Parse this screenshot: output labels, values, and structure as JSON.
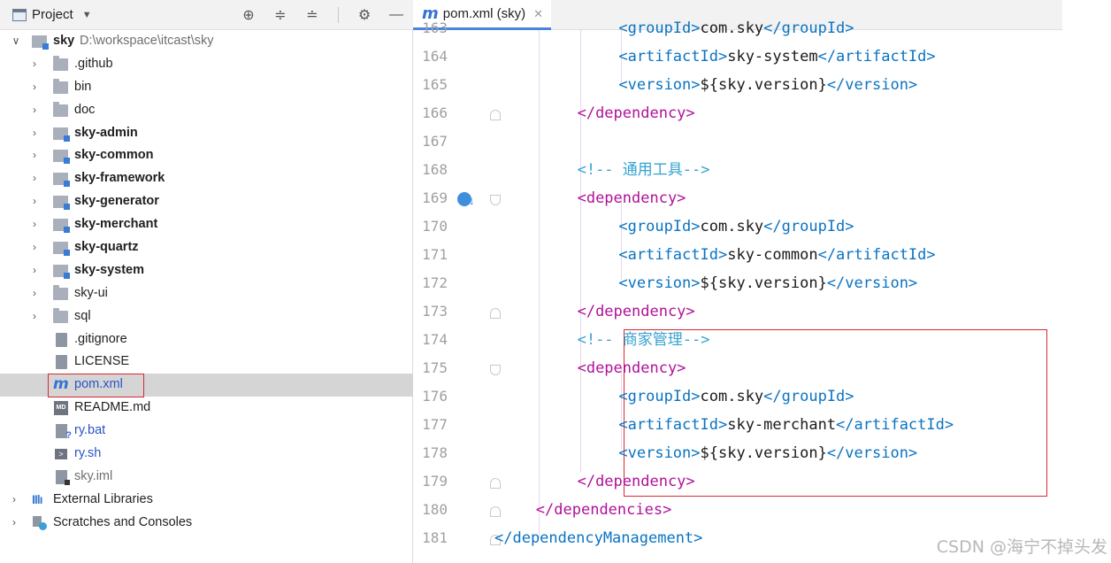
{
  "panel": {
    "title": "Project",
    "header_icons": [
      "locate-icon",
      "expand-all-icon",
      "collapse-all-icon",
      "gear-icon",
      "hide-icon"
    ]
  },
  "tree": {
    "root_name": "sky",
    "root_path": "D:\\workspace\\itcast\\sky",
    "items": [
      {
        "label": "sky",
        "path": "D:\\workspace\\itcast\\sky",
        "icon": "project-root-icon"
      },
      {
        "label": ".github",
        "icon": "folder-icon"
      },
      {
        "label": "bin",
        "icon": "folder-icon"
      },
      {
        "label": "doc",
        "icon": "folder-icon"
      },
      {
        "label": "sky-admin",
        "icon": "module-folder-icon"
      },
      {
        "label": "sky-common",
        "icon": "module-folder-icon"
      },
      {
        "label": "sky-framework",
        "icon": "module-folder-icon"
      },
      {
        "label": "sky-generator",
        "icon": "module-folder-icon"
      },
      {
        "label": "sky-merchant",
        "icon": "module-folder-icon"
      },
      {
        "label": "sky-quartz",
        "icon": "module-folder-icon"
      },
      {
        "label": "sky-system",
        "icon": "module-folder-icon"
      },
      {
        "label": "sky-ui",
        "icon": "folder-icon"
      },
      {
        "label": "sql",
        "icon": "folder-icon"
      },
      {
        "label": ".gitignore",
        "icon": "gitignore-file-icon"
      },
      {
        "label": "LICENSE",
        "icon": "text-file-icon"
      },
      {
        "label": "pom.xml",
        "icon": "maven-file-icon"
      },
      {
        "label": "README.md",
        "icon": "markdown-file-icon"
      },
      {
        "label": "ry.bat",
        "icon": "batch-file-icon"
      },
      {
        "label": "ry.sh",
        "icon": "shell-file-icon"
      },
      {
        "label": "sky.iml",
        "icon": "iml-file-icon"
      },
      {
        "label": "External Libraries",
        "icon": "libraries-icon"
      },
      {
        "label": "Scratches and Consoles",
        "icon": "scratches-icon"
      }
    ]
  },
  "editor": {
    "tab_label": "pom.xml (sky)",
    "tab_icon": "maven-file-icon",
    "lines": [
      {
        "num": "163",
        "parts": [
          {
            "c": "tag-blue",
            "t": "<groupId>"
          },
          {
            "c": "txt",
            "t": "com.sky"
          },
          {
            "c": "tag-blue",
            "t": "</groupId>"
          }
        ]
      },
      {
        "num": "164",
        "parts": [
          {
            "c": "tag-blue",
            "t": "<artifactId>"
          },
          {
            "c": "txt",
            "t": "sky-system"
          },
          {
            "c": "tag-blue",
            "t": "</artifactId>"
          }
        ]
      },
      {
        "num": "165",
        "parts": [
          {
            "c": "tag-blue",
            "t": "<version>"
          },
          {
            "c": "txt",
            "t": "${sky.version}"
          },
          {
            "c": "tag-blue",
            "t": "</version>"
          }
        ]
      },
      {
        "num": "166",
        "parts": [
          {
            "c": "tag",
            "t": "</dependency>"
          }
        ]
      },
      {
        "num": "167",
        "parts": []
      },
      {
        "num": "168",
        "parts": [
          {
            "c": "cmt",
            "t": "<!-- 通用工具-->"
          }
        ]
      },
      {
        "num": "169",
        "parts": [
          {
            "c": "tag",
            "t": "<dependency>"
          }
        ]
      },
      {
        "num": "170",
        "parts": [
          {
            "c": "tag-blue",
            "t": "<groupId>"
          },
          {
            "c": "txt",
            "t": "com.sky"
          },
          {
            "c": "tag-blue",
            "t": "</groupId>"
          }
        ]
      },
      {
        "num": "171",
        "parts": [
          {
            "c": "tag-blue",
            "t": "<artifactId>"
          },
          {
            "c": "txt",
            "t": "sky-common"
          },
          {
            "c": "tag-blue",
            "t": "</artifactId>"
          }
        ]
      },
      {
        "num": "172",
        "parts": [
          {
            "c": "tag-blue",
            "t": "<version>"
          },
          {
            "c": "txt",
            "t": "${sky.version}"
          },
          {
            "c": "tag-blue",
            "t": "</version>"
          }
        ]
      },
      {
        "num": "173",
        "parts": [
          {
            "c": "tag",
            "t": "</dependency>"
          }
        ]
      },
      {
        "num": "174",
        "parts": [
          {
            "c": "cmt",
            "t": "<!-- 商家管理-->"
          }
        ]
      },
      {
        "num": "175",
        "parts": [
          {
            "c": "tag",
            "t": "<dependency>"
          }
        ]
      },
      {
        "num": "176",
        "parts": [
          {
            "c": "tag-blue",
            "t": "<groupId>"
          },
          {
            "c": "txt",
            "t": "com.sky"
          },
          {
            "c": "tag-blue",
            "t": "</groupId>"
          }
        ]
      },
      {
        "num": "177",
        "parts": [
          {
            "c": "tag-blue",
            "t": "<artifactId>"
          },
          {
            "c": "txt",
            "t": "sky-merchant"
          },
          {
            "c": "tag-blue",
            "t": "</artifactId>"
          }
        ]
      },
      {
        "num": "178",
        "parts": [
          {
            "c": "tag-blue",
            "t": "<version>"
          },
          {
            "c": "txt",
            "t": "${sky.version}"
          },
          {
            "c": "tag-blue",
            "t": "</version>"
          }
        ]
      },
      {
        "num": "179",
        "parts": [
          {
            "c": "tag",
            "t": "</dependency>"
          }
        ]
      },
      {
        "num": "180",
        "parts": [
          {
            "c": "tag",
            "t": "</dependencies>"
          }
        ]
      },
      {
        "num": "181",
        "parts": [
          {
            "c": "tag-blue",
            "t": "</dependencyManagement>"
          }
        ]
      }
    ]
  },
  "watermark": "CSDN @海宁不掉头发",
  "colors": {
    "tag": "#b0119a",
    "tag_blue": "#0a73c1",
    "comment": "#35a3cf",
    "highlight": "#d9282f",
    "selection": "#d5d5d5"
  }
}
